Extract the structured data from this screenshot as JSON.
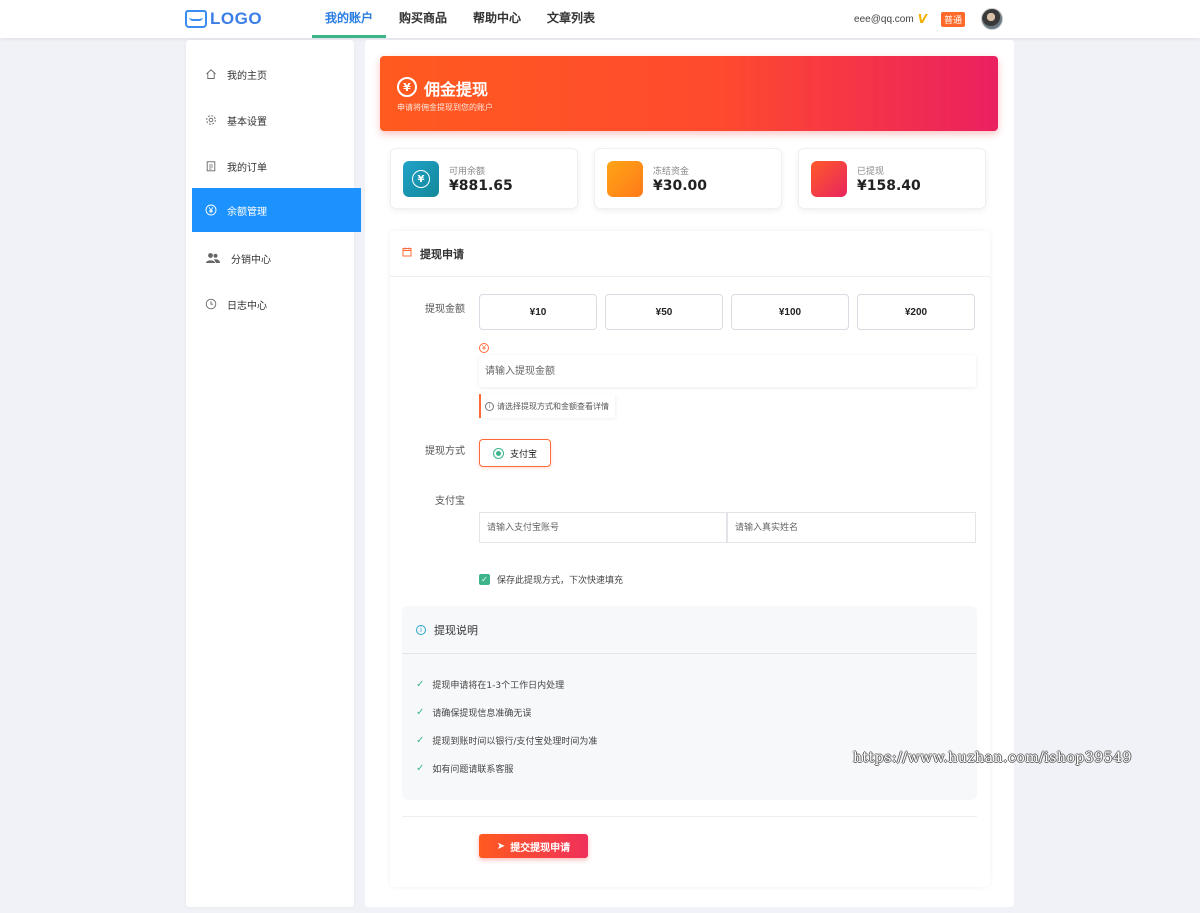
{
  "header": {
    "logo_text": "LOGO",
    "nav": [
      {
        "label": "我的账户",
        "active": true
      },
      {
        "label": "购买商品",
        "active": false
      },
      {
        "label": "帮助中心",
        "active": false
      },
      {
        "label": "文章列表",
        "active": false
      }
    ],
    "user_email": "eee@qq.com",
    "vip_mark": "V",
    "level_badge": "普通"
  },
  "sidebar": {
    "items": [
      {
        "label": "我的主页",
        "icon": "home-icon",
        "active": false
      },
      {
        "label": "基本设置",
        "icon": "gear-icon",
        "active": false
      },
      {
        "label": "我的订单",
        "icon": "clipboard-icon",
        "active": false
      },
      {
        "label": "余额管理",
        "icon": "yen-circle-icon",
        "active": true
      },
      {
        "label": "分销中心",
        "icon": "users-icon",
        "active": false
      },
      {
        "label": "日志中心",
        "icon": "clock-icon",
        "active": false
      }
    ]
  },
  "hero": {
    "icon_glyph": "¥",
    "title": "佣金提现",
    "subtitle": "申请将佣金提现到您的账户"
  },
  "stats": [
    {
      "label": "可用余额",
      "value": "¥881.65",
      "icon_glyph": "¥",
      "gradient": [
        "#1fa2c8",
        "#14889a"
      ]
    },
    {
      "label": "冻结资金",
      "value": "¥30.00",
      "icon_glyph": "",
      "gradient": [
        "#ffa515",
        "#ff7a1a"
      ]
    },
    {
      "label": "已提现",
      "value": "¥158.40",
      "icon_glyph": "",
      "gradient": [
        "#ff5a2a",
        "#e8245e"
      ]
    }
  ],
  "form": {
    "title": "提现申请",
    "amount_label": "提现金额",
    "amount_options": [
      "¥10",
      "¥50",
      "¥100",
      "¥200"
    ],
    "required_glyph": "¥",
    "amount_placeholder": "请输入提现金额",
    "hint_glyph": "i",
    "hint_text": "请选择提现方式和金额查看详情",
    "method_label": "提现方式",
    "method_option": "支付宝",
    "account_section_label": "支付宝",
    "account_placeholder": "请输入支付宝账号",
    "name_placeholder": "请输入真实姓名",
    "save_checkbox_label": "保存此提现方式，下次快速填充",
    "save_checked": true,
    "check_glyph": "✓"
  },
  "notes": {
    "icon_glyph": "i",
    "title": "提现说明",
    "check_glyph": "✓",
    "items": [
      "提现申请将在1-3个工作日内处理",
      "请确保提现信息准确无误",
      "提现到账时间以银行/支付宝处理时间为准",
      "如有问题请联系客服"
    ]
  },
  "submit": {
    "icon_glyph": "➤",
    "label": "提交提现申请"
  },
  "watermark": "https://www.huzhan.com/ishop39549",
  "colors": {
    "primary_blue": "#1c92ff",
    "accent_orange": "#ff5a1f",
    "accent_pink": "#ea2060",
    "success_green": "#3db48a"
  }
}
